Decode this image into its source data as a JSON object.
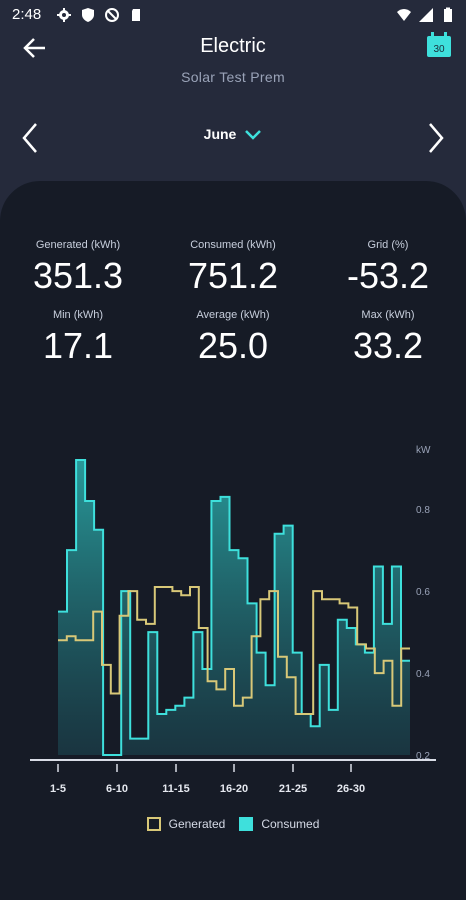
{
  "status_bar": {
    "time": "2:48"
  },
  "header": {
    "title": "Electric",
    "subtitle": "Solar Test Prem",
    "calendar_day": "30"
  },
  "month_nav": {
    "month": "June"
  },
  "stats": {
    "generated_label": "Generated (kWh)",
    "generated_value": "351.3",
    "consumed_label": "Consumed (kWh)",
    "consumed_value": "751.2",
    "grid_label": "Grid (%)",
    "grid_value": "-53.2",
    "min_label": "Min (kWh)",
    "min_value": "17.1",
    "average_label": "Average (kWh)",
    "average_value": "25.0",
    "max_label": "Max (kWh)",
    "max_value": "33.2"
  },
  "colors": {
    "generated": "#d8c878",
    "consumed": "#3ee0dc",
    "accent": "#3ee0dc"
  },
  "chart_data": {
    "type": "area",
    "step": true,
    "unit_label": "kW",
    "y_ticks": [
      "0.2",
      "0.4",
      "0.6",
      "0.8"
    ],
    "ylim": [
      0.2,
      0.92
    ],
    "x_tick_labels": [
      "1-5",
      "6-10",
      "11-15",
      "16-20",
      "21-25",
      "26-30"
    ],
    "series": [
      {
        "name": "Generated",
        "values": [
          0.48,
          0.49,
          0.48,
          0.48,
          0.55,
          0.42,
          0.35,
          0.54,
          0.6,
          0.53,
          0.52,
          0.61,
          0.61,
          0.6,
          0.59,
          0.61,
          0.51,
          0.38,
          0.36,
          0.41,
          0.32,
          0.34,
          0.49,
          0.58,
          0.6,
          0.44,
          0.39,
          0.3,
          0.3,
          0.6,
          0.58,
          0.58,
          0.57,
          0.56,
          0.47,
          0.46,
          0.4,
          0.43,
          0.32,
          0.46
        ]
      },
      {
        "name": "Consumed",
        "values": [
          0.55,
          0.7,
          0.92,
          0.82,
          0.75,
          0.2,
          0.2,
          0.6,
          0.24,
          0.24,
          0.5,
          0.3,
          0.31,
          0.32,
          0.34,
          0.5,
          0.41,
          0.82,
          0.83,
          0.7,
          0.68,
          0.57,
          0.45,
          0.37,
          0.74,
          0.76,
          0.45,
          0.3,
          0.27,
          0.42,
          0.31,
          0.53,
          0.51,
          0.47,
          0.45,
          0.66,
          0.52,
          0.66,
          0.43
        ]
      }
    ]
  },
  "legend": {
    "generated": "Generated",
    "consumed": "Consumed"
  }
}
